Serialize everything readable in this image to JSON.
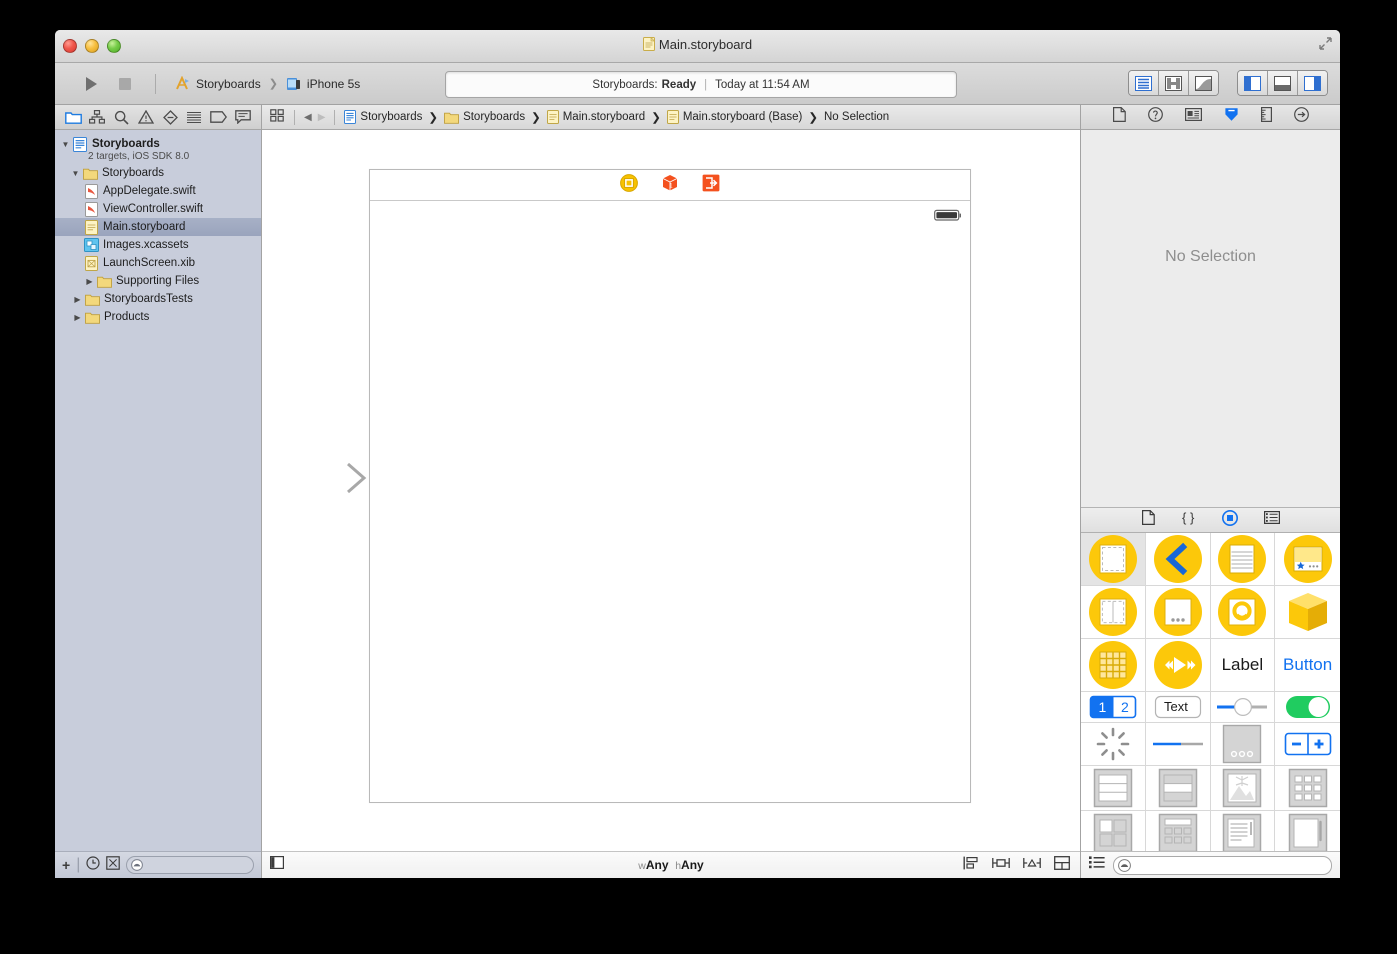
{
  "window": {
    "title": "Main.storyboard",
    "traffic": [
      "close",
      "minimize",
      "zoom"
    ]
  },
  "toolbar": {
    "run_label": "run-button",
    "stop_label": "stop-button",
    "scheme_project": "Storyboards",
    "scheme_destination": "iPhone 5s",
    "chevron": "❯",
    "status_prefix": "Storyboards:",
    "status_state": "Ready",
    "status_divider": "|",
    "status_time": "Today at 11:54 AM",
    "editor_modes": [
      "standard-editor",
      "assistant-editor",
      "version-editor"
    ],
    "view_toggles": [
      "navigator-toggle",
      "debug-area-toggle",
      "utilities-toggle"
    ]
  },
  "navigator": {
    "tabs": [
      "project-navigator",
      "symbol-navigator",
      "find-navigator",
      "issue-navigator",
      "test-navigator",
      "debug-navigator",
      "breakpoint-navigator",
      "report-navigator"
    ],
    "project": {
      "name": "Storyboards",
      "subtitle": "2 targets, iOS SDK 8.0"
    },
    "items": [
      {
        "label": "Storyboards",
        "icon": "folder",
        "indent": 1,
        "twisty": "down",
        "selected": false
      },
      {
        "label": "AppDelegate.swift",
        "icon": "swift",
        "indent": 2,
        "twisty": "",
        "selected": false
      },
      {
        "label": "ViewController.swift",
        "icon": "swift",
        "indent": 2,
        "twisty": "",
        "selected": false
      },
      {
        "label": "Main.storyboard",
        "icon": "storyboard",
        "indent": 2,
        "twisty": "",
        "selected": true
      },
      {
        "label": "Images.xcassets",
        "icon": "xcassets",
        "indent": 2,
        "twisty": "",
        "selected": false
      },
      {
        "label": "LaunchScreen.xib",
        "icon": "xib",
        "indent": 2,
        "twisty": "",
        "selected": false
      },
      {
        "label": "Supporting Files",
        "icon": "folder",
        "indent": 2,
        "twisty": "right",
        "selected": false
      },
      {
        "label": "StoryboardsTests",
        "icon": "folder",
        "indent": 1,
        "twisty": "right",
        "selected": false
      },
      {
        "label": "Products",
        "icon": "folder",
        "indent": 1,
        "twisty": "right",
        "selected": false
      }
    ],
    "filter": {
      "add_label": "+",
      "buttons": [
        "recent-files-filter",
        "source-control-filter"
      ],
      "placeholder": ""
    }
  },
  "editor": {
    "jumpbar": {
      "related_items": "related-items-button",
      "back": "◀",
      "forward": "▶",
      "breadcrumbs": [
        {
          "label": "Storyboards",
          "icon": "project"
        },
        {
          "label": "Storyboards",
          "icon": "folder"
        },
        {
          "label": "Main.storyboard",
          "icon": "storyboard"
        },
        {
          "label": "Main.storyboard (Base)",
          "icon": "storyboard"
        },
        {
          "label": "No Selection",
          "icon": ""
        }
      ],
      "chevron": "❯"
    },
    "scene": {
      "dock_icons": [
        "view-controller-icon",
        "first-responder-icon",
        "exit-icon"
      ],
      "status_bar": "battery-icon",
      "entry_point": "initial-view-controller-arrow"
    },
    "bottom": {
      "document_outline_toggle": "document-outline-button",
      "size_class_w_prefix": "w",
      "size_class_w": "Any",
      "size_class_h_prefix": "h",
      "size_class_h": "Any",
      "autolayout_buttons": [
        "align-button",
        "pin-button",
        "resolve-issues-button",
        "stack-button"
      ]
    }
  },
  "utilities": {
    "inspector_tabs": [
      "file-inspector",
      "quick-help-inspector",
      "identity-inspector",
      "attributes-inspector",
      "size-inspector",
      "connections-inspector"
    ],
    "inspector_selected": "attributes-inspector",
    "no_selection": "No Selection",
    "library_tabs": [
      "file-template-library",
      "code-snippet-library",
      "object-library",
      "media-library"
    ],
    "library_selected": "object-library",
    "library_items": [
      {
        "name": "View Controller",
        "kind": "vc-plain",
        "selected": true
      },
      {
        "name": "Navigation Controller",
        "kind": "vc-nav",
        "selected": false
      },
      {
        "name": "Table View Controller",
        "kind": "vc-table",
        "selected": false
      },
      {
        "name": "Tab Bar Controller",
        "kind": "vc-tabbar",
        "selected": false
      },
      {
        "name": "Split View Controller",
        "kind": "vc-split",
        "selected": false
      },
      {
        "name": "Page View Controller",
        "kind": "vc-page",
        "selected": false
      },
      {
        "name": "Collection View Controller",
        "kind": "vc-collection",
        "selected": false
      },
      {
        "name": "Object",
        "kind": "object-cube",
        "selected": false
      },
      {
        "name": "GLKit View Controller",
        "kind": "vc-glkit",
        "selected": false
      },
      {
        "name": "AVKit Player View Controller",
        "kind": "vc-avkit",
        "selected": false
      },
      {
        "name": "Label",
        "kind": "label",
        "selected": false,
        "text": "Label"
      },
      {
        "name": "Button",
        "kind": "button",
        "selected": false,
        "text": "Button"
      },
      {
        "name": "Segmented Control",
        "kind": "segmented",
        "selected": false,
        "seg1": "1",
        "seg2": "2"
      },
      {
        "name": "Text Field",
        "kind": "textfield",
        "selected": false,
        "text": "Text"
      },
      {
        "name": "Slider",
        "kind": "slider",
        "selected": false
      },
      {
        "name": "Switch",
        "kind": "switch",
        "selected": false
      },
      {
        "name": "Activity Indicator View",
        "kind": "activity",
        "selected": false
      },
      {
        "name": "Progress View",
        "kind": "progress",
        "selected": false
      },
      {
        "name": "Page Control",
        "kind": "pagecontrol",
        "selected": false
      },
      {
        "name": "Stepper",
        "kind": "stepper",
        "selected": false
      },
      {
        "name": "Table View",
        "kind": "tableview",
        "selected": false
      },
      {
        "name": "Table View Cell",
        "kind": "tablecell",
        "selected": false
      },
      {
        "name": "Image View",
        "kind": "imageview",
        "selected": false
      },
      {
        "name": "Collection View",
        "kind": "collectionview",
        "selected": false
      },
      {
        "name": "Collection Reusable View",
        "kind": "reusableview",
        "selected": false
      },
      {
        "name": "Collection View Cell",
        "kind": "collectioncell",
        "selected": false
      },
      {
        "name": "Text View",
        "kind": "textview",
        "selected": false
      },
      {
        "name": "Scroll View",
        "kind": "scrollview",
        "selected": false
      }
    ],
    "library_filter": {
      "list_toggle": "library-list-toggle",
      "placeholder": ""
    }
  },
  "colors": {
    "accent_blue": "#1272f0",
    "library_yellow": "#fcc80a",
    "scene_orange": "#f4511e",
    "switch_green": "#20cc60",
    "selection_blue": "#9aa4bd"
  }
}
